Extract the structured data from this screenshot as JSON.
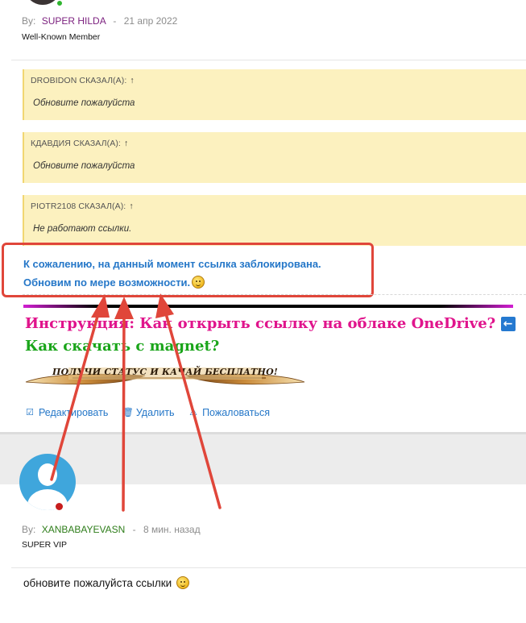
{
  "post1": {
    "by_label": "By:",
    "author": "SUPER HILDA",
    "author_color": "#7b1f7e",
    "date": "21 апр 2022",
    "role": "Well-Known Member"
  },
  "quotes": [
    {
      "header": "DROBIDON СКАЗАЛ(А):",
      "arrow": "↑",
      "text": "Обновите пожалуйста"
    },
    {
      "header": "КДАВДИЯ СКАЗАЛ(А):",
      "arrow": "↑",
      "text": "Обновите пожалуйста"
    },
    {
      "header": "PIOTR2108 СКАЗАЛ(А):",
      "arrow": "↑",
      "text": "Не работают ссылки."
    }
  ],
  "message": {
    "line1": "К сожалению, на данный момент ссылка заблокирована.",
    "line2": "Обновим по мере возможности."
  },
  "signature": {
    "instruction": "Инструкция: Как открыть ссылку на облаке OneDrive?",
    "instruction_icon": "back-arrow-icon",
    "magnet": "Как скачать с magnet?",
    "banner": "ПОЛУЧИ СТАТУС И КАЧАЙ БЕСПЛАТНО!"
  },
  "actions": {
    "edit": "Редактировать",
    "delete": "Удалить",
    "report": "Пожаловаться"
  },
  "post2": {
    "by_label": "By:",
    "author": "XANBABAYEVASN",
    "author_color": "#2e7d1a",
    "time": "8 мин. назад",
    "role": "SUPER VIP",
    "text": "обновите пожалуйста ссылки"
  },
  "colors": {
    "link_blue": "#2577c8",
    "quote_bg": "#fcf1bf",
    "annotation_red": "#e0463a",
    "instruction_pink": "#e0148c",
    "magnet_green": "#1aa51a"
  }
}
